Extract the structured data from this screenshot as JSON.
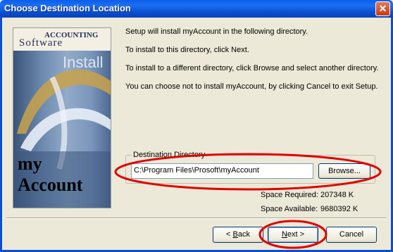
{
  "window": {
    "title": "Choose Destination Location",
    "close_glyph": "✕"
  },
  "banner": {
    "line1": "ACCOUNTING",
    "line2": "Software",
    "install": "Install",
    "product_line1": "my",
    "product_line2": "Account"
  },
  "instructions": {
    "line1": "Setup will install myAccount in the following directory.",
    "line2": "To install to this directory, click Next.",
    "line3": "To install to a different directory, click Browse and select another directory.",
    "line4": "You can choose not to install myAccount, by clicking Cancel to exit Setup."
  },
  "destination": {
    "group_label": "Destination Directory",
    "path": "C:\\Program Files\\Prosoft\\myAccount",
    "browse_label": "Browse..."
  },
  "space": {
    "required_label": "Space Required:",
    "required_value": "207348 K",
    "available_label": "Space Available:",
    "available_value": "9680392 K"
  },
  "buttons": {
    "back_prefix": "< ",
    "back_accel": "B",
    "back_rest": "ack",
    "next_accel": "N",
    "next_rest": "ext >",
    "cancel": "Cancel"
  },
  "colors": {
    "annotation": "#e00000",
    "title_bar": "#0a4fd0"
  }
}
